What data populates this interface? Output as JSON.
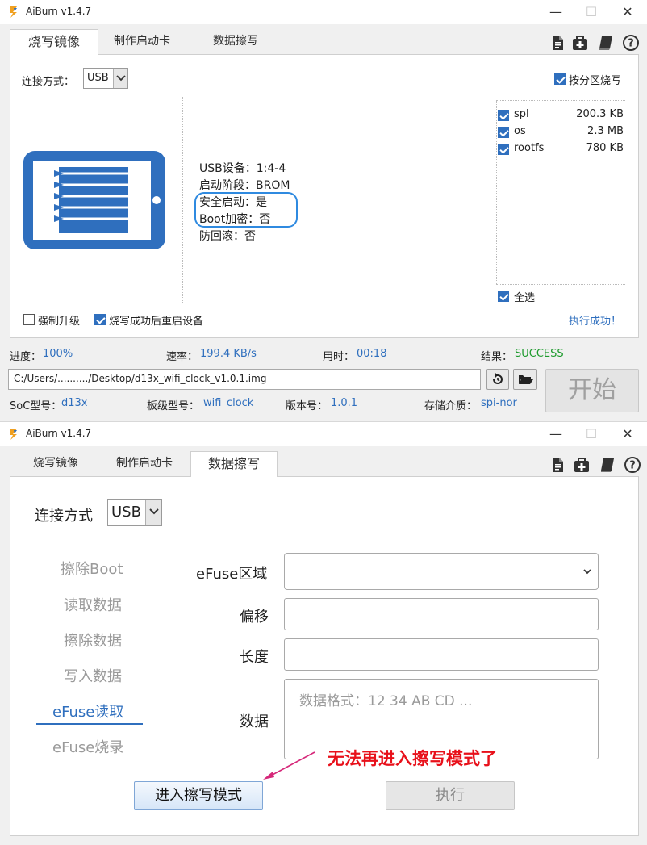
{
  "window1": {
    "title": "AiBurn v1.4.7",
    "tabs": [
      "烧写镜像",
      "制作启动卡",
      "数据擦写"
    ],
    "connection_label": "连接方式：",
    "connection_value": "USB",
    "partition_burn_label": "按分区烧写",
    "device_info": {
      "usb_device": "USB设备：1:4-4",
      "boot_stage": "启动阶段：BROM",
      "secure_boot": "安全启动：是",
      "boot_encrypt": "Boot加密：否",
      "anti_rollback": "防回滚：否"
    },
    "partitions": [
      {
        "name": "spl",
        "size": "200.3 KB",
        "checked": true
      },
      {
        "name": "os",
        "size": "2.3 MB",
        "checked": true
      },
      {
        "name": "rootfs",
        "size": "780 KB",
        "checked": true
      }
    ],
    "select_all_label": "全选",
    "force_upgrade_label": "强制升级",
    "reboot_label": "烧写成功后重启设备",
    "exec_status": "执行成功！",
    "progress_label": "进度：",
    "progress_value": "100%",
    "progress_fraction": 1.0,
    "speed_label": "速率：",
    "speed_value": "199.4 KB/s",
    "time_label": "用时：",
    "time_value": "00:18",
    "result_label": "结果：",
    "result_value": "SUCCESS",
    "file_path": "C:/Users/........../Desktop/d13x_wifi_clock_v1.0.1.img",
    "start_label": "开始",
    "soc_label": "SoC型号：",
    "soc_value": "d13x",
    "board_label": "板级型号：",
    "board_value": "wifi_clock",
    "version_label": "版本号：",
    "version_value": "1.0.1",
    "storage_label": "存储介质：",
    "storage_value": "spi-nor"
  },
  "window2": {
    "title": "AiBurn v1.4.7",
    "tabs": [
      "烧写镜像",
      "制作启动卡",
      "数据擦写"
    ],
    "connection_label": "连接方式",
    "connection_value": "USB",
    "side_menu": [
      "擦除Boot",
      "读取数据",
      "擦除数据",
      "写入数据",
      "eFuse读取",
      "eFuse烧录"
    ],
    "efuse_area_label": "eFuse区域",
    "offset_label": "偏移",
    "length_label": "长度",
    "data_label": "数据",
    "data_placeholder": "数据格式：12 34 AB CD ...",
    "enter_mode_button": "进入擦写模式",
    "execute_button": "执行",
    "annotation": "无法再进入擦写模式了"
  },
  "colors": {
    "accent_blue": "#2f6fbe",
    "success_green": "#1c9a2c",
    "annotation_red": "#e8101a",
    "arrow_pink": "#d6287a"
  }
}
